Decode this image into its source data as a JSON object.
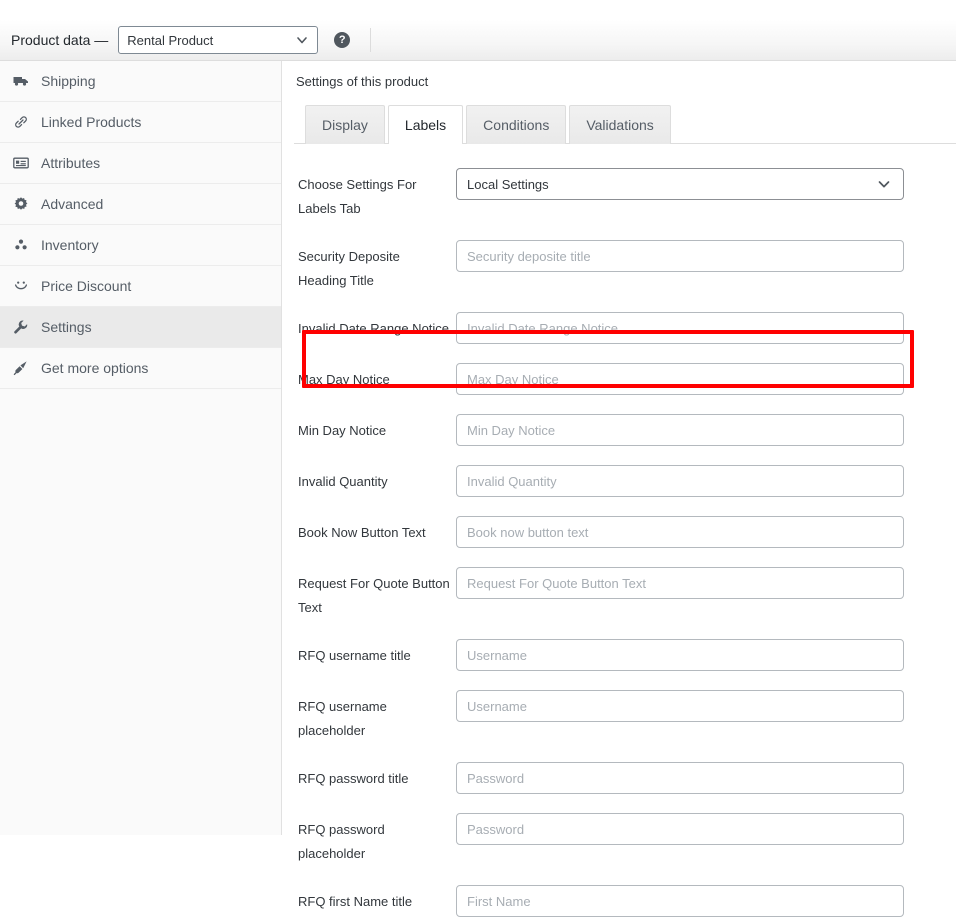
{
  "header": {
    "title": "Product data —",
    "product_type": "Rental Product",
    "product_type_options": [
      "Rental Product"
    ],
    "help_icon_label": "?"
  },
  "sidebar": {
    "items": [
      {
        "label": "Shipping",
        "icon": "truck-icon",
        "active": false
      },
      {
        "label": "Linked Products",
        "icon": "link-icon",
        "active": false
      },
      {
        "label": "Attributes",
        "icon": "list-box-icon",
        "active": false
      },
      {
        "label": "Advanced",
        "icon": "gear-icon",
        "active": false
      },
      {
        "label": "Inventory",
        "icon": "inventory-dots-icon",
        "active": false
      },
      {
        "label": "Price Discount",
        "icon": "smiley-icon",
        "active": false
      },
      {
        "label": "Settings",
        "icon": "wrench-icon",
        "active": true
      },
      {
        "label": "Get more options",
        "icon": "plug-icon",
        "active": false
      }
    ]
  },
  "main": {
    "heading": "Settings of this product",
    "tabs": [
      {
        "label": "Display",
        "active": false
      },
      {
        "label": "Labels",
        "active": true
      },
      {
        "label": "Conditions",
        "active": false
      },
      {
        "label": "Validations",
        "active": false
      }
    ],
    "fields": [
      {
        "label": "Choose Settings For Labels Tab",
        "type": "select",
        "value": "Local Settings",
        "options": [
          "Local Settings"
        ]
      },
      {
        "label": "Security Deposite Heading Title",
        "type": "text",
        "value": "",
        "placeholder": "Security deposite title"
      },
      {
        "label": "Invalid Date Range Notice",
        "type": "text",
        "value": "",
        "placeholder": "Invalid Date Range Notice"
      },
      {
        "label": "Max Day Notice",
        "type": "text",
        "value": "",
        "placeholder": "Max Day Notice",
        "highlighted": true
      },
      {
        "label": "Min Day Notice",
        "type": "text",
        "value": "",
        "placeholder": "Min Day Notice"
      },
      {
        "label": "Invalid Quantity",
        "type": "text",
        "value": "",
        "placeholder": "Invalid Quantity"
      },
      {
        "label": "Book Now Button Text",
        "type": "text",
        "value": "",
        "placeholder": "Book now button text"
      },
      {
        "label": "Request For Quote Button Text",
        "type": "text",
        "value": "",
        "placeholder": "Request For Quote Button Text"
      },
      {
        "label": "RFQ username title",
        "type": "text",
        "value": "",
        "placeholder": "Username"
      },
      {
        "label": "RFQ username placeholder",
        "type": "text",
        "value": "",
        "placeholder": "Username"
      },
      {
        "label": "RFQ password title",
        "type": "text",
        "value": "",
        "placeholder": "Password"
      },
      {
        "label": "RFQ password placeholder",
        "type": "text",
        "value": "",
        "placeholder": "Password"
      },
      {
        "label": "RFQ first Name title",
        "type": "text",
        "value": "",
        "placeholder": "First Name"
      }
    ]
  },
  "colors": {
    "highlight": "#ff0000",
    "sidebar_bg": "#fafafa",
    "active_item_bg": "#eaeaea",
    "border": "#dddddd"
  }
}
